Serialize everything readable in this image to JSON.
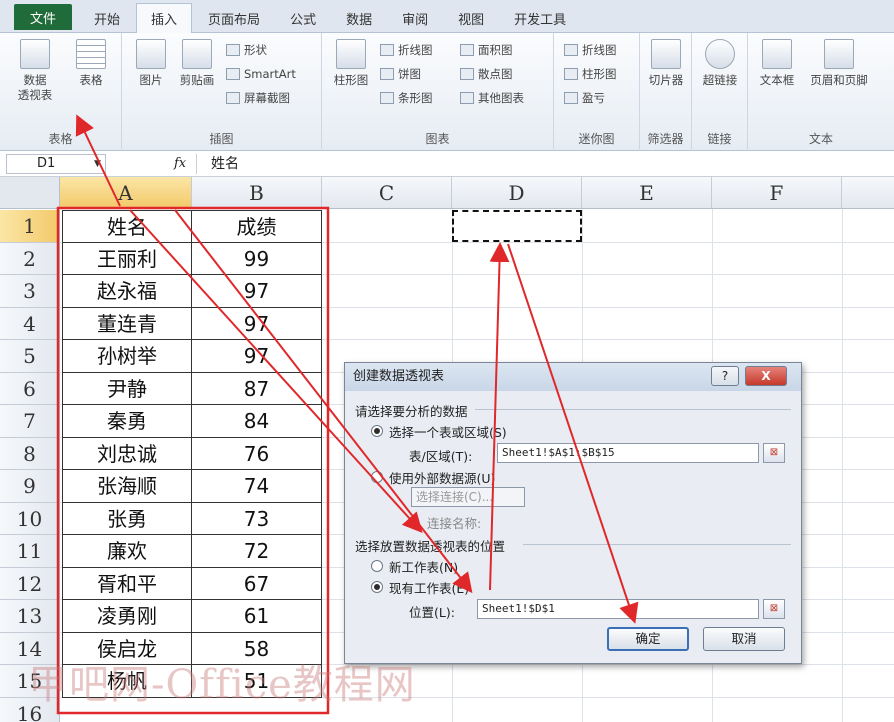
{
  "tabs": [
    "文件",
    "开始",
    "插入",
    "页面布局",
    "公式",
    "数据",
    "审阅",
    "视图",
    "开发工具"
  ],
  "ribbon": {
    "tables": {
      "label": "表格",
      "pivot": "数据\n透视表",
      "table": "表格"
    },
    "illustrations": {
      "label": "插图",
      "picture": "图片",
      "clipart": "剪贴画",
      "shapes": "形状",
      "smartart": "SmartArt",
      "screenshot": "屏幕截图"
    },
    "charts": {
      "label": "图表",
      "column": "柱形图",
      "line": "折线图",
      "pie": "饼图",
      "bar": "条形图",
      "area": "面积图",
      "scatter": "散点图",
      "other": "其他图表"
    },
    "sparklines": {
      "label": "迷你图",
      "line": "折线图",
      "column": "柱形图",
      "winloss": "盈亏"
    },
    "filter": {
      "label": "筛选器",
      "slicer": "切片器"
    },
    "links": {
      "label": "链接",
      "hyperlink": "超链接"
    },
    "text": {
      "label": "文本",
      "textbox": "文本框",
      "header": "页眉和页脚"
    }
  },
  "formula_bar": {
    "name_box": "D1",
    "fx": "fx",
    "value": "姓名"
  },
  "columns": [
    "A",
    "B",
    "C",
    "D",
    "E",
    "F"
  ],
  "rows": [
    "1",
    "2",
    "3",
    "4",
    "5",
    "6",
    "7",
    "8",
    "9",
    "10",
    "11",
    "12",
    "13",
    "14",
    "15",
    "16"
  ],
  "table": {
    "headers": [
      "姓名",
      "成绩"
    ],
    "data": [
      [
        "王丽利",
        "99"
      ],
      [
        "赵永福",
        "97"
      ],
      [
        "董连青",
        "97"
      ],
      [
        "孙树举",
        "97"
      ],
      [
        "尹静",
        "87"
      ],
      [
        "秦勇",
        "84"
      ],
      [
        "刘忠诚",
        "76"
      ],
      [
        "张海顺",
        "74"
      ],
      [
        "张勇",
        "73"
      ],
      [
        "廉欢",
        "72"
      ],
      [
        "胥和平",
        "67"
      ],
      [
        "凌勇刚",
        "61"
      ],
      [
        "侯启龙",
        "58"
      ],
      [
        "杨帆",
        "51"
      ]
    ]
  },
  "dialog": {
    "title": "创建数据透视表",
    "help": "?",
    "close": "X",
    "section1": "请选择要分析的数据",
    "opt_range": "选择一个表或区域(S)",
    "range_label": "表/区域(T):",
    "range_value": "Sheet1!$A$1:$B$15",
    "opt_external": "使用外部数据源(U)",
    "choose_conn": "选择连接(C)...",
    "conn_name": "连接名称:",
    "section2": "选择放置数据透视表的位置",
    "opt_new": "新工作表(N)",
    "opt_existing": "现有工作表(E)",
    "location_label": "位置(L):",
    "location_value": "Sheet1!$D$1",
    "ok": "确定",
    "cancel": "取消"
  },
  "watermark": "甲吧网-Office教程网",
  "colors": {
    "file_tab": "#1f6b3a",
    "annotation": "#e0282a",
    "selected_header": "#f3c96a"
  }
}
